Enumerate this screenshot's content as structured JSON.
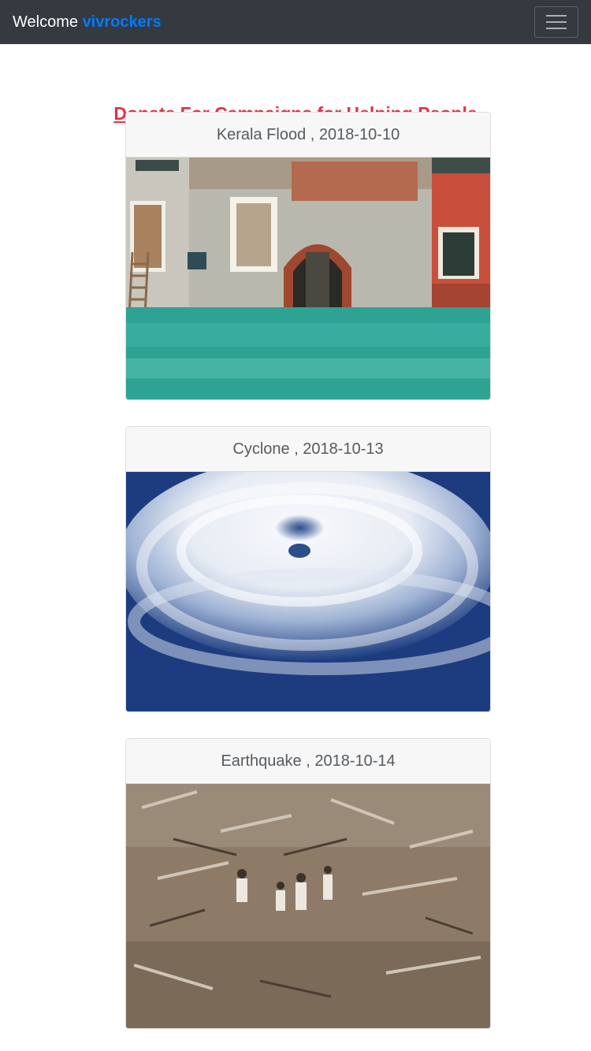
{
  "navbar": {
    "welcome": "Welcome",
    "username": "vivrockers",
    "menu_icon": "hamburger-menu-icon"
  },
  "page": {
    "heading": "Donate For Campaigns for Helping People"
  },
  "campaigns": [
    {
      "title": "Kerala Flood , 2018-10-10",
      "image": "flooded-building-image"
    },
    {
      "title": "Cyclone , 2018-10-13",
      "image": "cyclone-satellite-image"
    },
    {
      "title": "Earthquake , 2018-10-14",
      "image": "earthquake-rubble-image"
    }
  ],
  "colors": {
    "navbar": "#343a40",
    "username": "#007bff",
    "heading": "#dc3545"
  }
}
